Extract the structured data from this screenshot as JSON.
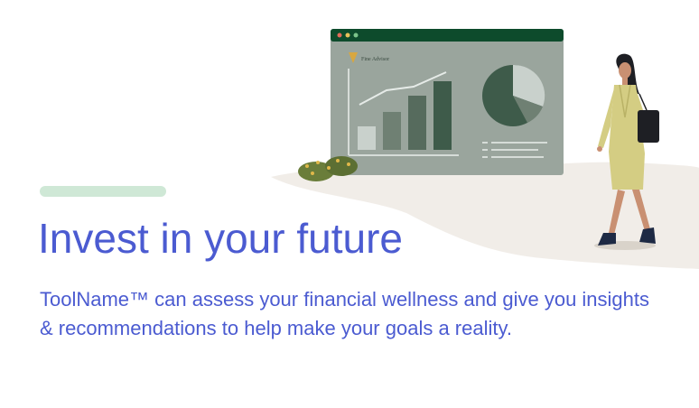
{
  "hero": {
    "app_logo": "Fine Advisor",
    "headline": "Invest in your future",
    "description": "ToolName™ can assess your financial wellness and give you insights & recommendations to help make your goals a reality.",
    "colors": {
      "accent_bar": "#cfe8d6",
      "text": "#4b5bd1",
      "window_header": "#0d4b2c",
      "window_body": "#9aa59d",
      "chart_dark": "#3e5b4a"
    },
    "illustration_icons": [
      "browser-window-icon",
      "bar-chart-icon",
      "pie-chart-icon",
      "shrub-icon",
      "woman-figure-icon"
    ]
  }
}
